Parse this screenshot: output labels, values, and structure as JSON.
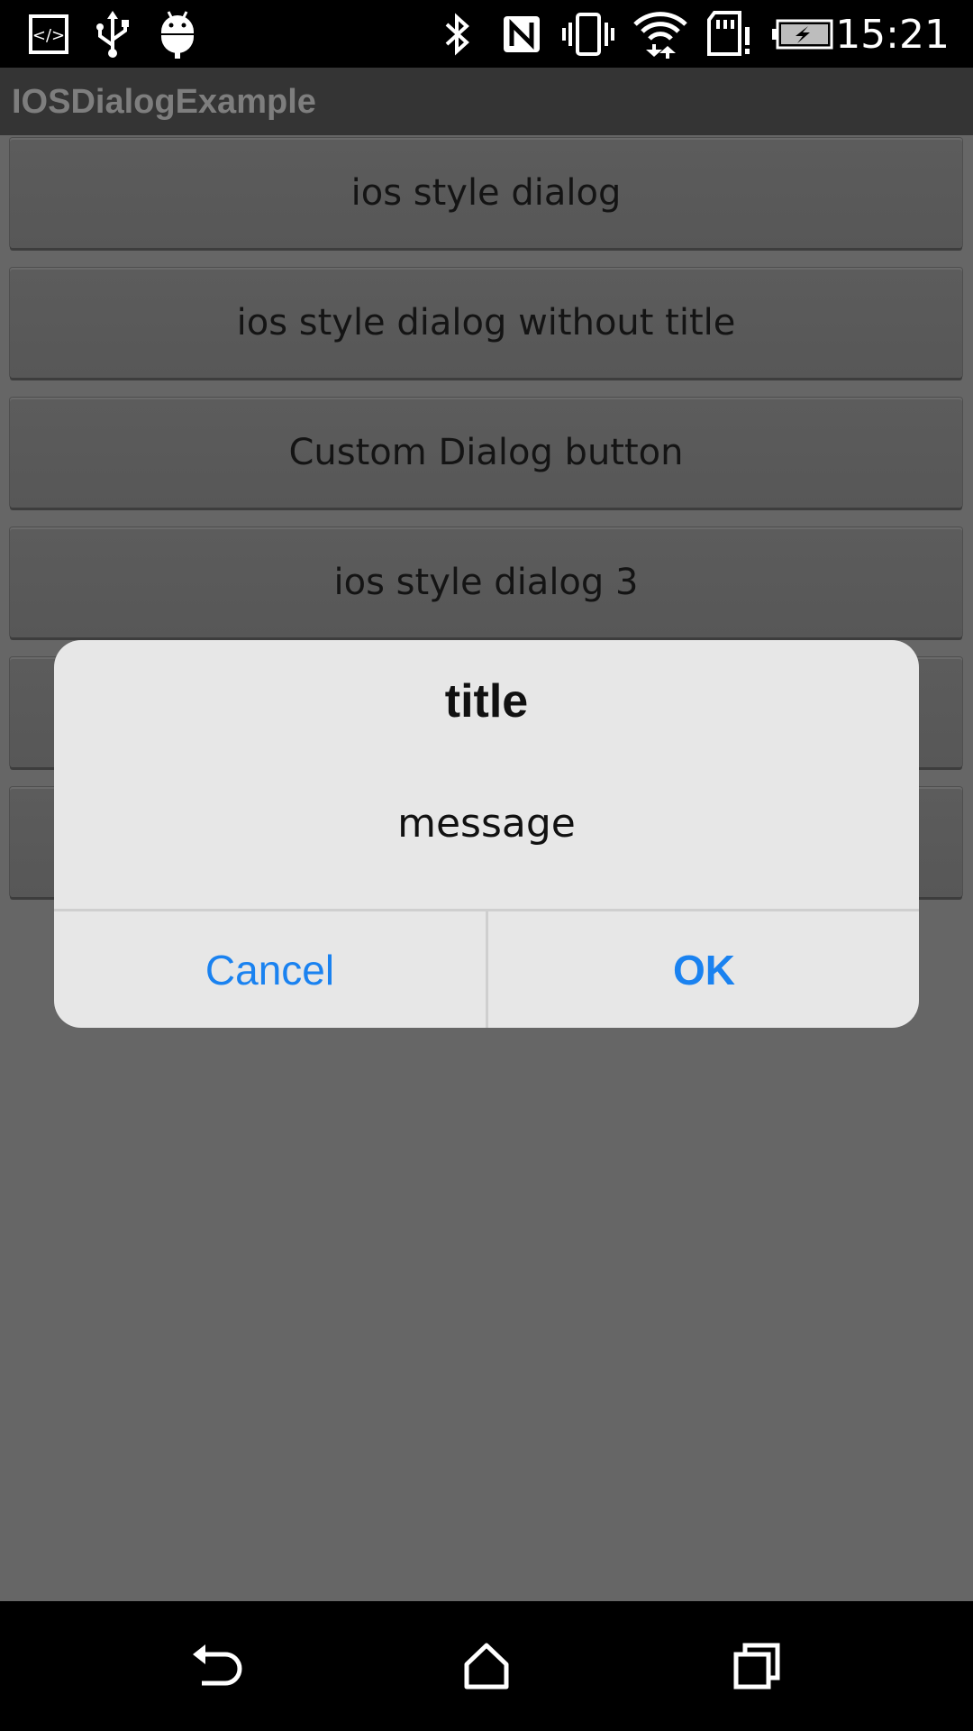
{
  "status_bar": {
    "time": "15:21",
    "icons": [
      "dev-tools-icon",
      "usb-icon",
      "android-debug-icon",
      "bluetooth-icon",
      "nfc-icon",
      "vibrate-icon",
      "wifi-icon",
      "sd-card-alert-icon",
      "battery-charging-icon"
    ]
  },
  "action_bar": {
    "title": "IOSDialogExample"
  },
  "buttons": [
    {
      "label": "ios style dialog"
    },
    {
      "label": "ios style dialog without title"
    },
    {
      "label": "Custom Dialog button"
    },
    {
      "label": "ios style dialog 3"
    },
    {
      "label": ""
    },
    {
      "label": ""
    }
  ],
  "dialog": {
    "title": "title",
    "message": "message",
    "cancel_label": "Cancel",
    "ok_label": "OK",
    "accent_color": "#1a82f0"
  },
  "nav_bar": {
    "icons": [
      "back-icon",
      "home-icon",
      "recents-icon"
    ]
  },
  "colors": {
    "content_background": "#666666",
    "dialog_background": "#e7e7e7",
    "action_bar": "#343434"
  }
}
